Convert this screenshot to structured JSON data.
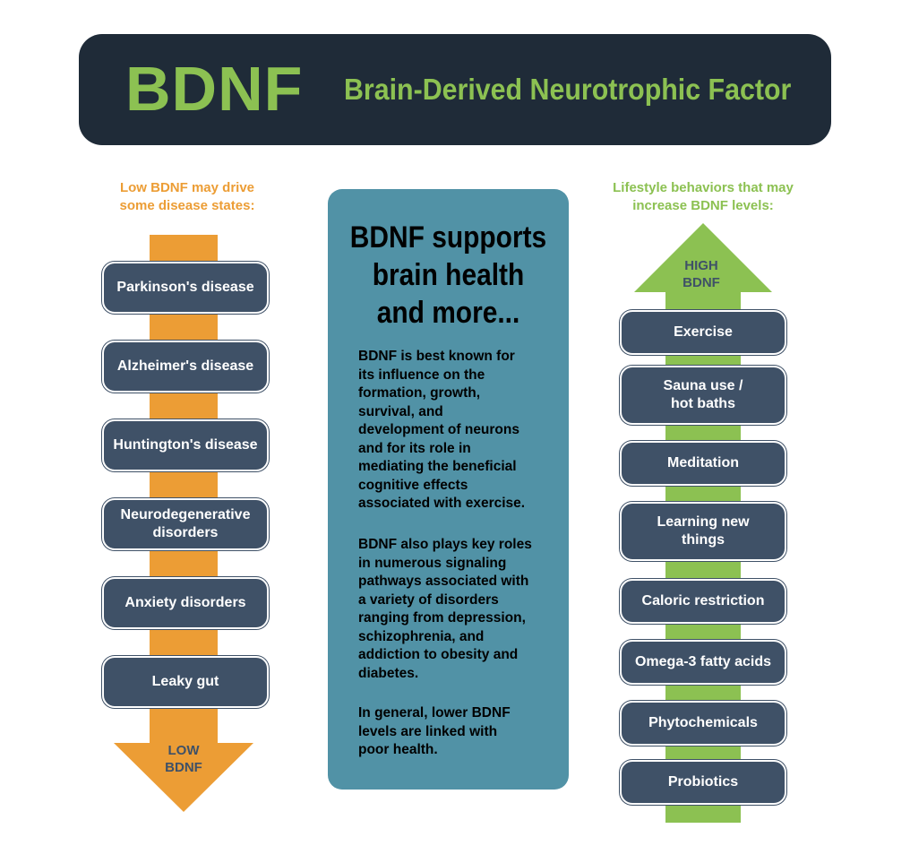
{
  "header": {
    "acronym": "BDNF",
    "full_name": "Brain-Derived Neurotrophic Factor"
  },
  "left_column": {
    "caption_line1": "Low BDNF may drive",
    "caption_line2": "some disease states:",
    "arrow_label_line1": "LOW",
    "arrow_label_line2": "BDNF",
    "items": [
      {
        "line1": "Parkinson's disease",
        "line2": ""
      },
      {
        "line1": "Alzheimer's disease",
        "line2": ""
      },
      {
        "line1": "Huntington's disease",
        "line2": ""
      },
      {
        "line1": "Neurodegenerative",
        "line2": "disorders"
      },
      {
        "line1": "Anxiety disorders",
        "line2": ""
      },
      {
        "line1": "Leaky gut",
        "line2": ""
      }
    ]
  },
  "center_panel": {
    "title_line1": "BDNF supports",
    "title_line2": "brain health",
    "title_line3": "and more...",
    "paragraph1": [
      "BDNF is best known for",
      "its influence on the",
      "formation, growth,",
      "survival, and",
      "development of neurons",
      "and for its role in",
      "mediating the beneficial",
      "cognitive effects",
      "associated with exercise."
    ],
    "paragraph2": [
      "BDNF also plays key roles",
      "in numerous signaling",
      "pathways associated with",
      "a variety of disorders",
      "ranging from depression,",
      "schizophrenia, and",
      "addiction to obesity and",
      "diabetes."
    ],
    "paragraph3": [
      "In general, lower BDNF",
      "levels are linked with",
      "poor health."
    ]
  },
  "right_column": {
    "caption_line1": "Lifestyle behaviors that may",
    "caption_line2": "increase BDNF levels:",
    "arrow_label_line1": "HIGH",
    "arrow_label_line2": "BDNF",
    "items": [
      {
        "line1": "Exercise",
        "line2": ""
      },
      {
        "line1": "Sauna use /",
        "line2": "hot baths"
      },
      {
        "line1": "Meditation",
        "line2": ""
      },
      {
        "line1": "Learning new",
        "line2": "things"
      },
      {
        "line1": "Caloric restriction",
        "line2": ""
      },
      {
        "line1": "Omega-3 fatty acids",
        "line2": ""
      },
      {
        "line1": "Phytochemicals",
        "line2": ""
      },
      {
        "line1": "Probiotics",
        "line2": ""
      }
    ]
  },
  "colors": {
    "header_bg": "#1f2b38",
    "green_accent": "#8cc152",
    "orange_accent": "#ec9d35",
    "pill_bg": "#3f5167",
    "center_panel_bg": "#5192a6"
  }
}
